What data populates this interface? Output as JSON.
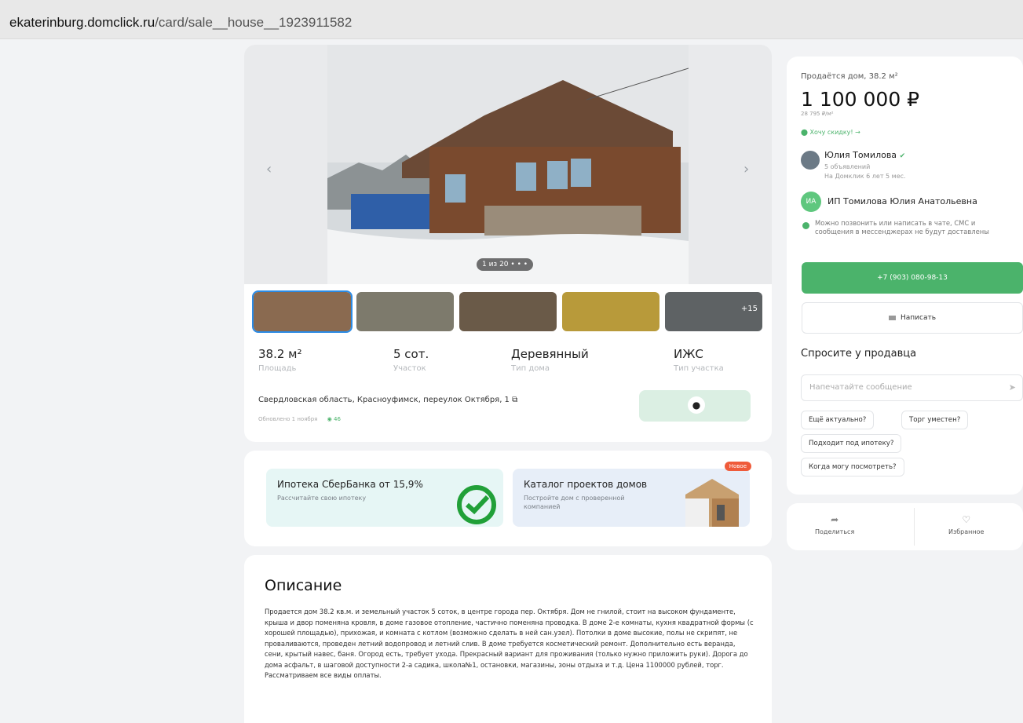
{
  "browser": {
    "url_host": "ekaterinburg.domclick.ru",
    "url_path": "/card/sale__house__1923911582"
  },
  "gallery": {
    "counter": "1 из 20 • • •",
    "more_photos": "+15"
  },
  "stats": [
    {
      "value": "38.2 м²",
      "label": "Площадь"
    },
    {
      "value": "5 сот.",
      "label": "Участок"
    },
    {
      "value": "Деревянный",
      "label": "Тип дома"
    },
    {
      "value": "ИЖС",
      "label": "Тип участка"
    }
  ],
  "address": {
    "text": "Свердловская область, Красноуфимск, переулок Октября, 1",
    "published": "Обновлено 1 ноября",
    "views": "46"
  },
  "promos": {
    "sber": {
      "title": "Ипотека СберБанка от 15,9%",
      "subtitle": "Рассчитайте свою ипотеку"
    },
    "catalog": {
      "title": "Каталог проектов домов",
      "subtitle": "Постройте дом с проверенной компанией",
      "badge": "Новое"
    }
  },
  "description": {
    "heading": "Описание",
    "text": "Продается дом 38.2 кв.м. и земельный участок 5 соток, в центре города пер. Октября. Дом не гнилой, стоит на высоком фундаменте, крыша и двор поменяна кровля, в доме газовое отопление, частично поменяна проводка. В доме 2-е комнаты, кухня квадратной формы (с хорошей площадью), прихожая, и комната с котлом (возможно сделать в ней сан.узел). Потолки в доме высокие, полы не скрипят, не проваливаются, проведен летний водопровод и летний слив. В доме требуется косметический ремонт. Дополнительно есть веранда, сени, крытый навес, баня. Огород есть, требует ухода. Прекрасный вариант для проживания (только нужно приложить руки). Дорога до дома асфальт, в шаговой доступности 2-а садика, школа№1, остановки, магазины, зоны отдыха и т.д. Цена 1100000 рублей, торг. Рассматриваем все виды оплаты."
  },
  "sidebar": {
    "title": "Продаётся дом, 38.2 м²",
    "price": "1 100 000 ₽",
    "price_per_m2": "28 795 ₽/м²",
    "discount_link": "Хочу скидку! →",
    "agent": {
      "name": "Юлия Томилова",
      "listings": "5 объявлений",
      "tenure": "На Домклик 6 лет 5 мес."
    },
    "org": {
      "initials": "ИА",
      "name": "ИП Томилова Юлия Анатольевна"
    },
    "contact_note": "Можно позвонить или написать в чате, СМС и сообщения в мессенджерах не будут доставлены",
    "phone_button": "+7 (903) 080-98-13",
    "write_button": "Написать",
    "ask_heading": "Спросите у продавца",
    "message_placeholder": "Напечатайте сообщение",
    "quick_questions": [
      "Ещё актуально?",
      "Торг уместен?",
      "Подходит под ипотеку?",
      "Когда могу посмотреть?"
    ]
  },
  "actions": {
    "share": "Поделиться",
    "favorite": "Избранное"
  },
  "colors": {
    "accent_green": "#4bb36b",
    "badge_red": "#ef5b3a"
  }
}
